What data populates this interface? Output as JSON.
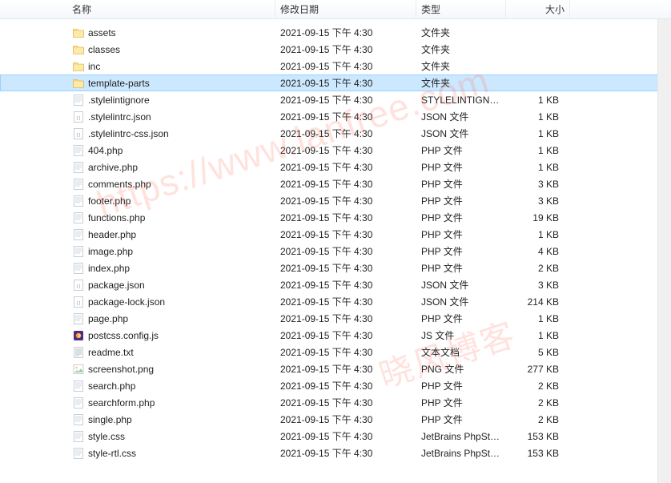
{
  "columns": {
    "name": "名称",
    "modified": "修改日期",
    "type": "类型",
    "size": "大小"
  },
  "watermarks": {
    "url": "https://www.lanfree.com",
    "text": "晓风博客"
  },
  "items": [
    {
      "icon": "folder",
      "name": "assets",
      "modified": "2021-09-15  下午 4:30",
      "type": "文件夹",
      "size": "",
      "selected": false
    },
    {
      "icon": "folder",
      "name": "classes",
      "modified": "2021-09-15  下午 4:30",
      "type": "文件夹",
      "size": "",
      "selected": false
    },
    {
      "icon": "folder",
      "name": "inc",
      "modified": "2021-09-15  下午 4:30",
      "type": "文件夹",
      "size": "",
      "selected": false
    },
    {
      "icon": "folder",
      "name": "template-parts",
      "modified": "2021-09-15  下午 4:30",
      "type": "文件夹",
      "size": "",
      "selected": true
    },
    {
      "icon": "file",
      "name": ".stylelintignore",
      "modified": "2021-09-15  下午 4:30",
      "type": "STYLELINTIGNO...",
      "size": "1 KB",
      "selected": false
    },
    {
      "icon": "json",
      "name": ".stylelintrc.json",
      "modified": "2021-09-15  下午 4:30",
      "type": "JSON 文件",
      "size": "1 KB",
      "selected": false
    },
    {
      "icon": "json",
      "name": ".stylelintrc-css.json",
      "modified": "2021-09-15  下午 4:30",
      "type": "JSON 文件",
      "size": "1 KB",
      "selected": false
    },
    {
      "icon": "php",
      "name": "404.php",
      "modified": "2021-09-15  下午 4:30",
      "type": "PHP 文件",
      "size": "1 KB",
      "selected": false
    },
    {
      "icon": "php",
      "name": "archive.php",
      "modified": "2021-09-15  下午 4:30",
      "type": "PHP 文件",
      "size": "1 KB",
      "selected": false
    },
    {
      "icon": "php",
      "name": "comments.php",
      "modified": "2021-09-15  下午 4:30",
      "type": "PHP 文件",
      "size": "3 KB",
      "selected": false
    },
    {
      "icon": "php",
      "name": "footer.php",
      "modified": "2021-09-15  下午 4:30",
      "type": "PHP 文件",
      "size": "3 KB",
      "selected": false
    },
    {
      "icon": "php",
      "name": "functions.php",
      "modified": "2021-09-15  下午 4:30",
      "type": "PHP 文件",
      "size": "19 KB",
      "selected": false
    },
    {
      "icon": "php",
      "name": "header.php",
      "modified": "2021-09-15  下午 4:30",
      "type": "PHP 文件",
      "size": "1 KB",
      "selected": false
    },
    {
      "icon": "php",
      "name": "image.php",
      "modified": "2021-09-15  下午 4:30",
      "type": "PHP 文件",
      "size": "4 KB",
      "selected": false
    },
    {
      "icon": "php",
      "name": "index.php",
      "modified": "2021-09-15  下午 4:30",
      "type": "PHP 文件",
      "size": "2 KB",
      "selected": false
    },
    {
      "icon": "json",
      "name": "package.json",
      "modified": "2021-09-15  下午 4:30",
      "type": "JSON 文件",
      "size": "3 KB",
      "selected": false
    },
    {
      "icon": "json",
      "name": "package-lock.json",
      "modified": "2021-09-15  下午 4:30",
      "type": "JSON 文件",
      "size": "214 KB",
      "selected": false
    },
    {
      "icon": "php",
      "name": "page.php",
      "modified": "2021-09-15  下午 4:30",
      "type": "PHP 文件",
      "size": "1 KB",
      "selected": false
    },
    {
      "icon": "js",
      "name": "postcss.config.js",
      "modified": "2021-09-15  下午 4:30",
      "type": "JS 文件",
      "size": "1 KB",
      "selected": false
    },
    {
      "icon": "txt",
      "name": "readme.txt",
      "modified": "2021-09-15  下午 4:30",
      "type": "文本文档",
      "size": "5 KB",
      "selected": false
    },
    {
      "icon": "png",
      "name": "screenshot.png",
      "modified": "2021-09-15  下午 4:30",
      "type": "PNG 文件",
      "size": "277 KB",
      "selected": false
    },
    {
      "icon": "php",
      "name": "search.php",
      "modified": "2021-09-15  下午 4:30",
      "type": "PHP 文件",
      "size": "2 KB",
      "selected": false
    },
    {
      "icon": "php",
      "name": "searchform.php",
      "modified": "2021-09-15  下午 4:30",
      "type": "PHP 文件",
      "size": "2 KB",
      "selected": false
    },
    {
      "icon": "php",
      "name": "single.php",
      "modified": "2021-09-15  下午 4:30",
      "type": "PHP 文件",
      "size": "2 KB",
      "selected": false
    },
    {
      "icon": "css",
      "name": "style.css",
      "modified": "2021-09-15  下午 4:30",
      "type": "JetBrains PhpSto...",
      "size": "153 KB",
      "selected": false
    },
    {
      "icon": "css",
      "name": "style-rtl.css",
      "modified": "2021-09-15  下午 4:30",
      "type": "JetBrains PhpSto...",
      "size": "153 KB",
      "selected": false
    }
  ]
}
